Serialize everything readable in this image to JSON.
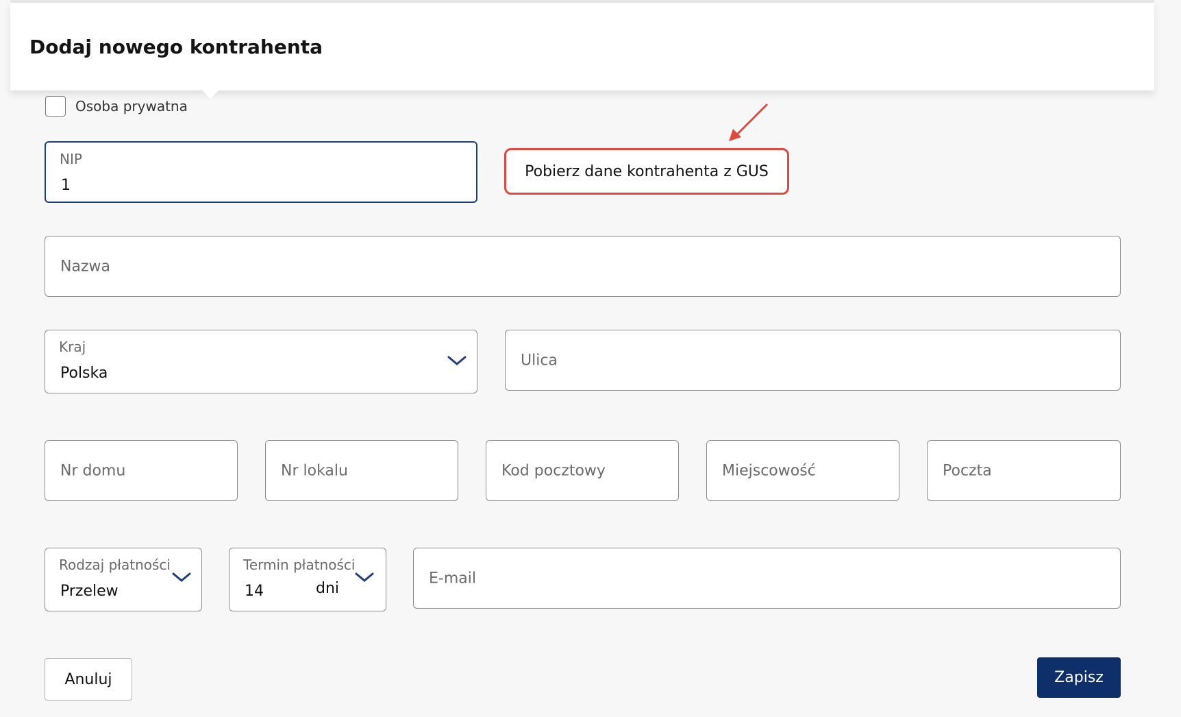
{
  "dialog": {
    "title": "Dodaj nowego kontrahenta"
  },
  "private_person": {
    "label": "Osoba prywatna",
    "checked": false
  },
  "nip": {
    "label": "NIP",
    "value": "1"
  },
  "gus_button": {
    "label": "Pobierz dane kontrahenta z GUS",
    "highlight_color": "#e0493f"
  },
  "fields": {
    "name_placeholder": "Nazwa",
    "country_label": "Kraj",
    "country_value": "Polska",
    "street_placeholder": "Ulica",
    "house_no_placeholder": "Nr domu",
    "apartment_no_placeholder": "Nr lokalu",
    "postal_code_placeholder": "Kod pocztowy",
    "city_placeholder": "Miejscowość",
    "post_office_placeholder": "Poczta",
    "payment_type_label": "Rodzaj płatności",
    "payment_type_value": "Przelew",
    "payment_term_label": "Termin płatności",
    "payment_term_value": "14",
    "payment_term_unit": "dni",
    "email_placeholder": "E-mail"
  },
  "actions": {
    "cancel_label": "Anuluj",
    "save_label": "Zapisz"
  },
  "colors": {
    "primary": "#0f2f6b",
    "active_border": "#1f3f7a",
    "chevron": "#1f3f7a"
  },
  "icons": {
    "dropdown": "chevron-down-icon",
    "annotation": "red-arrow-icon"
  }
}
